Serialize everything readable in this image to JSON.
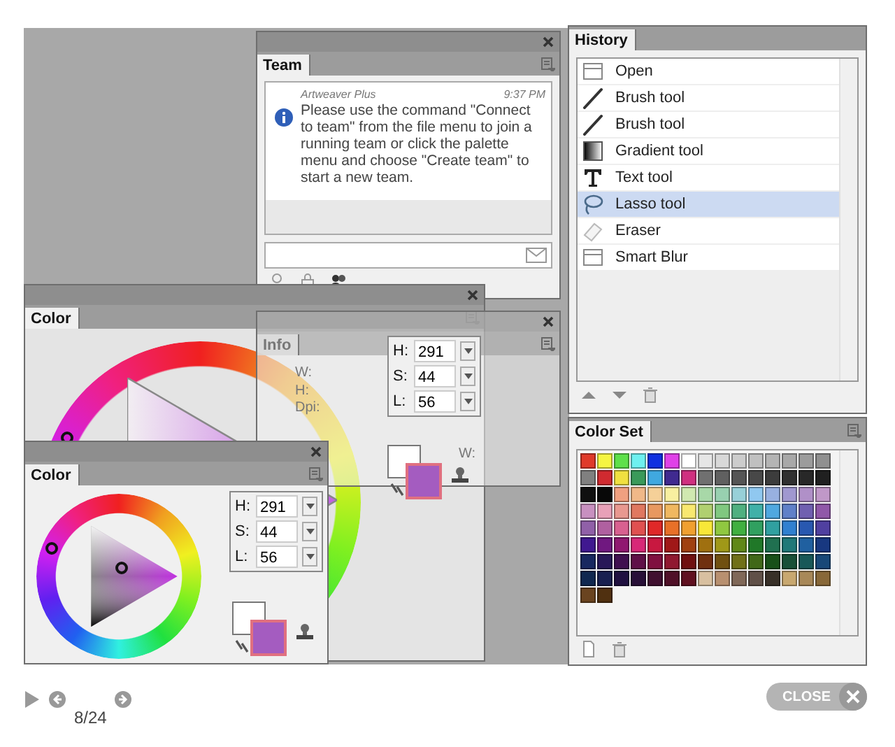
{
  "team": {
    "tab": "Team",
    "sender": "Artweaver Plus",
    "time": "9:37 PM",
    "message": "Please use the command \"Connect to team\" from the file menu to join a running team or click the palette menu and choose \"Create team\" to start a new team."
  },
  "history": {
    "tab": "History",
    "items": [
      {
        "label": "Open",
        "kind": "document",
        "selected": false
      },
      {
        "label": "Brush tool",
        "kind": "brush",
        "selected": false
      },
      {
        "label": "Brush tool",
        "kind": "brush",
        "selected": false
      },
      {
        "label": "Gradient tool",
        "kind": "gradient",
        "selected": false
      },
      {
        "label": "Text tool",
        "kind": "text",
        "selected": false
      },
      {
        "label": "Lasso tool",
        "kind": "lasso",
        "selected": true
      },
      {
        "label": "Eraser",
        "kind": "eraser",
        "selected": false
      },
      {
        "label": "Smart Blur",
        "kind": "document",
        "selected": false
      }
    ]
  },
  "info": {
    "tab": "Info",
    "labels": [
      "W:",
      "H:",
      "Dpi:",
      "W:"
    ]
  },
  "color_panels": [
    {
      "tab": "Color",
      "fields": [
        {
          "label": "H:",
          "value": "291"
        },
        {
          "label": "S:",
          "value": "44"
        },
        {
          "label": "L:",
          "value": "56"
        }
      ]
    },
    {
      "tab": "Color",
      "fields": [
        {
          "label": "H:",
          "value": "291"
        },
        {
          "label": "S:",
          "value": "44"
        },
        {
          "label": "L:",
          "value": "56"
        }
      ]
    }
  ],
  "color_set": {
    "tab": "Color Set",
    "swatches": [
      {
        "color": "#e03a2a"
      },
      {
        "color": "#f5f542"
      },
      {
        "color": "#5ee04a"
      },
      {
        "color": "#6ef0f0"
      },
      {
        "color": "#1030e0"
      },
      {
        "color": "#e040e8"
      },
      {
        "color": "#ffffff"
      },
      {
        "color": "#e6e6e6"
      },
      {
        "color": "#d8d8d8"
      },
      {
        "color": "#cccccc"
      },
      {
        "color": "#c0c0c0"
      },
      {
        "color": "#b4b4b4"
      },
      {
        "color": "#a8a8a8"
      },
      {
        "color": "#9c9c9c"
      },
      {
        "color": "#909090"
      },
      {
        "color": "#808080"
      },
      {
        "color": "#d02a30"
      },
      {
        "color": "#f0e040"
      },
      {
        "color": "#3a9a5a"
      },
      {
        "color": "#40a8e0"
      },
      {
        "color": "#402a90"
      },
      {
        "color": "#d03080"
      },
      {
        "color": "#707070"
      },
      {
        "color": "#606060"
      },
      {
        "color": "#555555"
      },
      {
        "color": "#484848"
      },
      {
        "color": "#3c3c3c"
      },
      {
        "color": "#303030"
      },
      {
        "color": "#282828"
      },
      {
        "color": "#202020"
      },
      {
        "color": "#101010"
      },
      {
        "color": "#080808"
      },
      {
        "color": "#f0a080"
      },
      {
        "color": "#f0b888"
      },
      {
        "color": "#f5d098"
      },
      {
        "color": "#f8f0a0"
      },
      {
        "color": "#d0e8b0"
      },
      {
        "color": "#a8d8a8"
      },
      {
        "color": "#98d0b0"
      },
      {
        "color": "#98d0d8"
      },
      {
        "color": "#90c8f0"
      },
      {
        "color": "#98b0e0"
      },
      {
        "color": "#a098d0"
      },
      {
        "color": "#b090c8"
      },
      {
        "color": "#c098c8"
      },
      {
        "color": "#c890c0"
      },
      {
        "color": "#e8a0b8"
      },
      {
        "color": "#e89890"
      },
      {
        "color": "#e07860"
      },
      {
        "color": "#e89860"
      },
      {
        "color": "#f0b860"
      },
      {
        "color": "#f8e870"
      },
      {
        "color": "#b0d070"
      },
      {
        "color": "#80c880"
      },
      {
        "color": "#50b080"
      },
      {
        "color": "#40b0a8"
      },
      {
        "color": "#50a8e0"
      },
      {
        "color": "#6080c8"
      },
      {
        "color": "#7060b0"
      },
      {
        "color": "#9058a8"
      },
      {
        "color": "#9060a8"
      },
      {
        "color": "#b060a0"
      },
      {
        "color": "#d86090"
      },
      {
        "color": "#e05050"
      },
      {
        "color": "#e02828"
      },
      {
        "color": "#e87028"
      },
      {
        "color": "#f0a030"
      },
      {
        "color": "#f8e838"
      },
      {
        "color": "#90c840"
      },
      {
        "color": "#40b040"
      },
      {
        "color": "#30a060"
      },
      {
        "color": "#30a0a0"
      },
      {
        "color": "#3080d0"
      },
      {
        "color": "#2858b0"
      },
      {
        "color": "#5040a0"
      },
      {
        "color": "#401890"
      },
      {
        "color": "#701880"
      },
      {
        "color": "#901870"
      },
      {
        "color": "#d82878"
      },
      {
        "color": "#c81840"
      },
      {
        "color": "#a01818"
      },
      {
        "color": "#a04010"
      },
      {
        "color": "#a07010"
      },
      {
        "color": "#a09818"
      },
      {
        "color": "#608818"
      },
      {
        "color": "#207828"
      },
      {
        "color": "#207050"
      },
      {
        "color": "#207878"
      },
      {
        "color": "#2060a0"
      },
      {
        "color": "#183880"
      },
      {
        "color": "#182860"
      },
      {
        "color": "#281858"
      },
      {
        "color": "#401050"
      },
      {
        "color": "#601048"
      },
      {
        "color": "#801040"
      },
      {
        "color": "#901830"
      },
      {
        "color": "#701010"
      },
      {
        "color": "#703010"
      },
      {
        "color": "#705010"
      },
      {
        "color": "#707018"
      },
      {
        "color": "#406818"
      },
      {
        "color": "#185018"
      },
      {
        "color": "#185038"
      },
      {
        "color": "#185858"
      },
      {
        "color": "#184878"
      },
      {
        "color": "#102850"
      },
      {
        "color": "#182050"
      },
      {
        "color": "#201040"
      },
      {
        "color": "#281038"
      },
      {
        "color": "#401030"
      },
      {
        "color": "#501028"
      },
      {
        "color": "#601020"
      },
      {
        "color": "#d8c0a0"
      },
      {
        "color": "#b89070"
      },
      {
        "color": "#806858"
      },
      {
        "color": "#605048"
      },
      {
        "color": "#383028"
      },
      {
        "color": "#c8a870"
      },
      {
        "color": "#a88858"
      },
      {
        "color": "#886838"
      },
      {
        "color": "#6a4420"
      },
      {
        "color": "#503010"
      }
    ]
  },
  "viewer": {
    "counter": "8/24",
    "close": "CLOSE"
  }
}
